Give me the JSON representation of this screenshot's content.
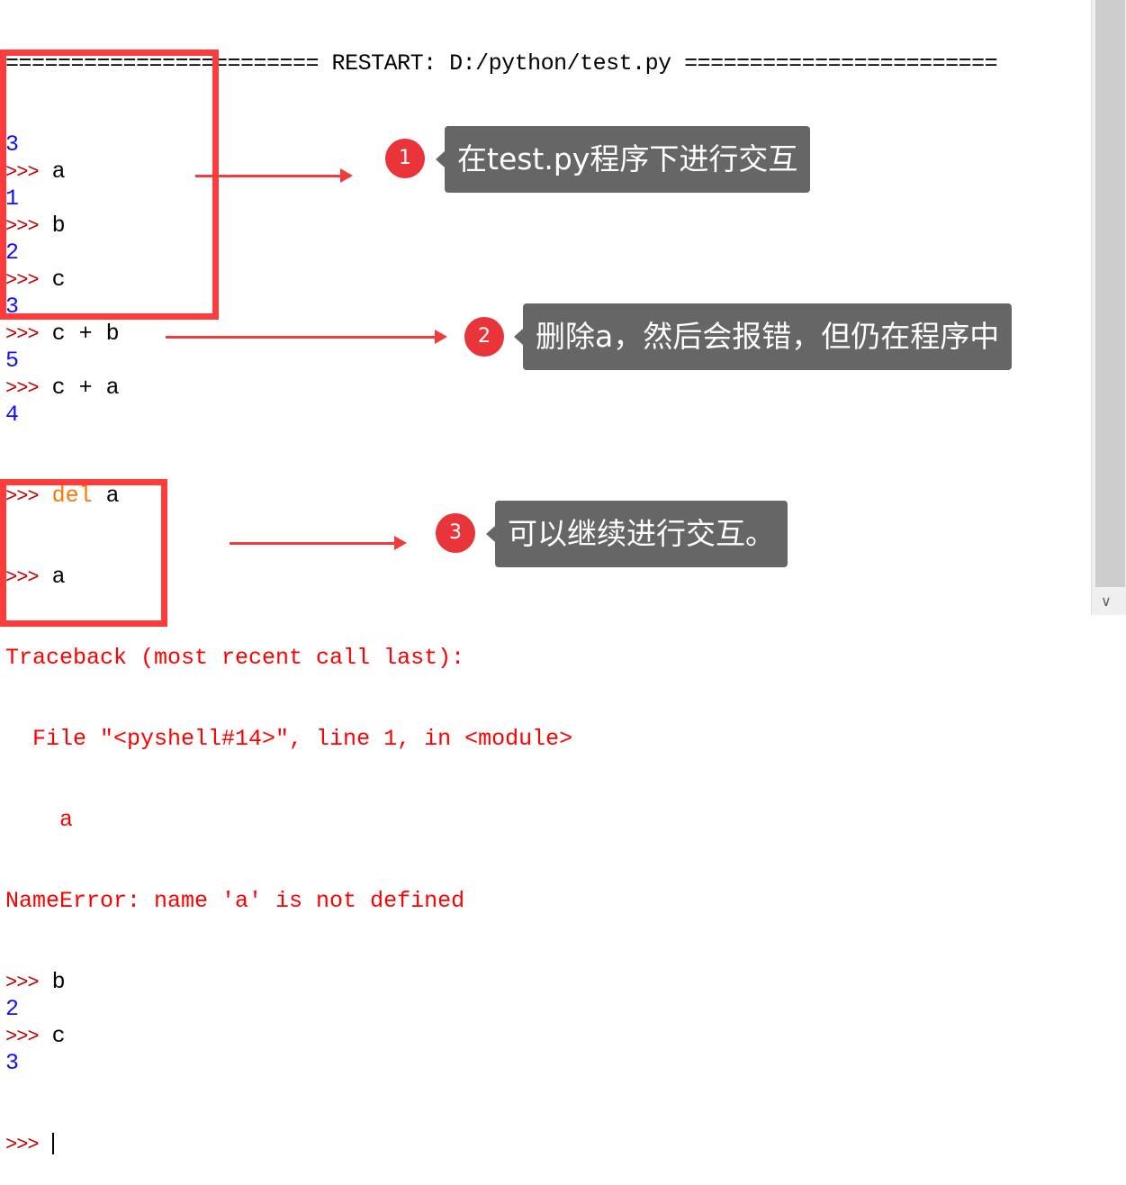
{
  "shell": {
    "header": "======================== RESTART: D:/python/test.py ========================",
    "prompt": ">>>",
    "lines": [
      {
        "type": "out",
        "text": "3"
      },
      {
        "type": "in",
        "text": "a"
      },
      {
        "type": "out",
        "text": "1"
      },
      {
        "type": "in",
        "text": "b"
      },
      {
        "type": "out",
        "text": "2"
      },
      {
        "type": "in",
        "text": "c"
      },
      {
        "type": "out",
        "text": "3"
      },
      {
        "type": "in",
        "text": "c + b"
      },
      {
        "type": "out",
        "text": "5"
      },
      {
        "type": "in",
        "text": "c + a"
      },
      {
        "type": "out",
        "text": "4"
      }
    ],
    "del_kw": "del",
    "del_arg": "a",
    "a_input": "a",
    "traceback": [
      "Traceback (most recent call last):",
      "  File \"<pyshell#14>\", line 1, in <module>",
      "    a",
      "NameError: name 'a' is not defined"
    ],
    "after": [
      {
        "type": "in",
        "text": "b"
      },
      {
        "type": "out",
        "text": "2"
      },
      {
        "type": "in",
        "text": "c"
      },
      {
        "type": "out",
        "text": "3"
      }
    ]
  },
  "annotations": [
    {
      "num": "1",
      "text": "在test.py程序下进行交互"
    },
    {
      "num": "2",
      "text": "删除a，然后会报错，但仍在程序中"
    },
    {
      "num": "3",
      "text": "可以继续进行交互。"
    }
  ]
}
